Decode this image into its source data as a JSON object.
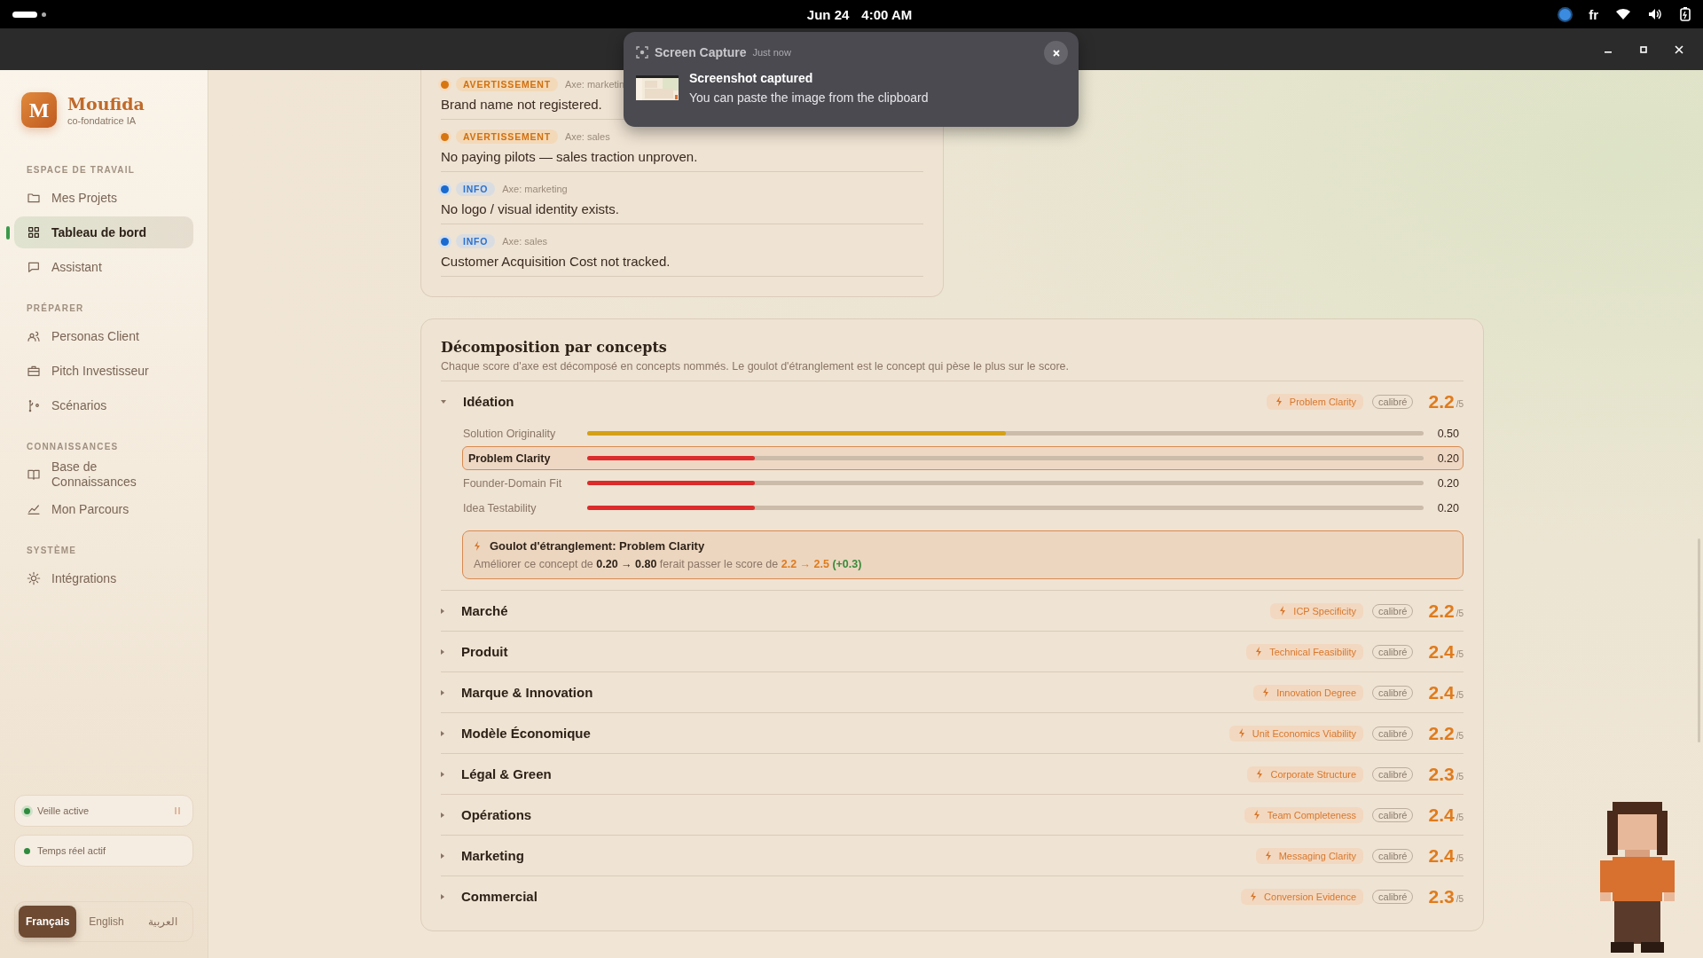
{
  "system_bar": {
    "date": "Jun 24",
    "time": "4:00 AM",
    "language": "fr"
  },
  "notification": {
    "app": "Screen Capture",
    "when": "Just now",
    "title": "Screenshot captured",
    "body": "You can paste the image from the clipboard"
  },
  "sidebar": {
    "brand": {
      "initial": "M",
      "name": "Moufida",
      "subtitle": "co-fondatrice IA"
    },
    "sections": [
      {
        "label": "ESPACE DE TRAVAIL",
        "items": [
          {
            "label": "Mes Projets",
            "selected": false
          },
          {
            "label": "Tableau de bord",
            "selected": true
          },
          {
            "label": "Assistant",
            "selected": false
          }
        ]
      },
      {
        "label": "PRÉPARER",
        "items": [
          {
            "label": "Personas Client",
            "selected": false
          },
          {
            "label": "Pitch Investisseur",
            "selected": false
          },
          {
            "label": "Scénarios",
            "selected": false
          }
        ]
      },
      {
        "label": "CONNAISSANCES",
        "items": [
          {
            "label": "Base de Connaissances",
            "selected": false
          },
          {
            "label": "Mon Parcours",
            "selected": false
          }
        ]
      },
      {
        "label": "SYSTÈME",
        "items": [
          {
            "label": "Intégrations",
            "selected": false
          }
        ]
      }
    ],
    "status": [
      {
        "label": "Veille active",
        "on": true
      },
      {
        "label": "Temps réel actif",
        "on": true
      }
    ],
    "languages": [
      {
        "label": "Français",
        "selected": true
      },
      {
        "label": "English",
        "selected": false
      },
      {
        "label": "العربية",
        "selected": false
      }
    ]
  },
  "alerts": [
    {
      "kind": "warning",
      "tag": "AVERTISSEMENT",
      "axis": "Axe: marketin",
      "text": "Brand name not registered."
    },
    {
      "kind": "warning",
      "tag": "AVERTISSEMENT",
      "axis": "Axe: sales",
      "text": "No paying pilots — sales traction unproven."
    },
    {
      "kind": "info",
      "tag": "INFO",
      "axis": "Axe: marketing",
      "text": "No logo / visual identity exists."
    },
    {
      "kind": "info",
      "tag": "INFO",
      "axis": "Axe: sales",
      "text": "Customer Acquisition Cost not tracked."
    }
  ],
  "concepts_panel": {
    "title": "Décomposition par concepts",
    "subtitle": "Chaque score d'axe est décomposé en concepts nommés. Le goulot d'étranglement est le concept qui pèse le plus sur le score.",
    "axes": [
      {
        "name": "Idéation",
        "expanded": true,
        "bottleneck": "Problem Clarity",
        "tag": "calibré",
        "score": "2.2",
        "scale": "/5",
        "concepts": [
          {
            "name": "Solution Originality",
            "level": 0.5,
            "reading": "0.50",
            "selected": false,
            "color": "#d4a017"
          },
          {
            "name": "Problem Clarity",
            "level": 0.2,
            "reading": "0.20",
            "selected": true,
            "color": "#dc2b2b"
          },
          {
            "name": "Founder-Domain Fit",
            "level": 0.2,
            "reading": "0.20",
            "selected": false,
            "color": "#dc2b2b"
          },
          {
            "name": "Idea Testability",
            "level": 0.2,
            "reading": "0.20",
            "selected": false,
            "color": "#dc2b2b"
          }
        ],
        "note": {
          "title": "Goulot d'étranglement: Problem Clarity",
          "parts": [
            {
              "kind": "plain",
              "text": "Améliorer ce concept de "
            },
            {
              "kind": "bold",
              "text": "0.20 → 0.80"
            },
            {
              "kind": "plain",
              "text": " ferait passer le score de "
            },
            {
              "kind": "accent",
              "text": "2.2 → 2.5"
            },
            {
              "kind": "gain",
              "text": " (+0.3)"
            }
          ]
        }
      },
      {
        "name": "Marché",
        "expanded": false,
        "bottleneck": "ICP Specificity",
        "tag": "calibré",
        "score": "2.2",
        "scale": "/5"
      },
      {
        "name": "Produit",
        "expanded": false,
        "bottleneck": "Technical Feasibility",
        "tag": "calibré",
        "score": "2.4",
        "scale": "/5"
      },
      {
        "name": "Marque & Innovation",
        "expanded": false,
        "bottleneck": "Innovation Degree",
        "tag": "calibré",
        "score": "2.4",
        "scale": "/5"
      },
      {
        "name": "Modèle Économique",
        "expanded": false,
        "bottleneck": "Unit Economics Viability",
        "tag": "calibré",
        "score": "2.2",
        "scale": "/5"
      },
      {
        "name": "Légal & Green",
        "expanded": false,
        "bottleneck": "Corporate Structure",
        "tag": "calibré",
        "score": "2.3",
        "scale": "/5"
      },
      {
        "name": "Opérations",
        "expanded": false,
        "bottleneck": "Team Completeness",
        "tag": "calibré",
        "score": "2.4",
        "scale": "/5"
      },
      {
        "name": "Marketing",
        "expanded": false,
        "bottleneck": "Messaging Clarity",
        "tag": "calibré",
        "score": "2.4",
        "scale": "/5"
      },
      {
        "name": "Commercial",
        "expanded": false,
        "bottleneck": "Conversion Evidence",
        "tag": "calibré",
        "score": "2.3",
        "scale": "/5"
      }
    ]
  }
}
